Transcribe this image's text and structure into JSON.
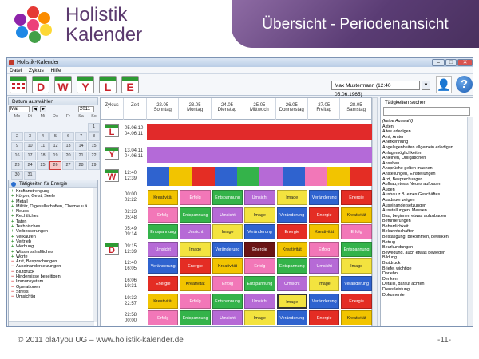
{
  "brand": {
    "line1": "Holistik",
    "line2": "Kalender"
  },
  "slide_title": "Übersicht - Periodenansicht",
  "colors": {
    "Kreativität": "#f2c400",
    "Erfolg": "#f277b8",
    "Entspannung": "#34b34a",
    "Umsicht": "#b66ad6",
    "Image": "#f3e33f",
    "Veränderung": "#2f63cf",
    "Energie": "#e42d24",
    "selected": "#6b1414"
  },
  "window": {
    "title": "Holistik-Kalender",
    "menu": [
      "Datei",
      "Zyklus",
      "Hilfe"
    ],
    "toolbar_letters": [
      "D",
      "W",
      "Y",
      "L",
      "E"
    ],
    "user": "Max Mustermann (12:40 05.06.1965)"
  },
  "calendar": {
    "header": "Datum auswählen",
    "month": "Mai",
    "year": "2011",
    "weekdays": [
      "Mo",
      "Di",
      "Mi",
      "Do",
      "Fr",
      "Sa",
      "So"
    ],
    "days": [
      "",
      "",
      "",
      "",
      "",
      "",
      "1",
      "2",
      "3",
      "4",
      "5",
      "6",
      "7",
      "8",
      "9",
      "10",
      "11",
      "12",
      "13",
      "14",
      "15",
      "16",
      "17",
      "18",
      "19",
      "20",
      "21",
      "22",
      "23",
      "24",
      "25",
      "26",
      "27",
      "28",
      "29",
      "30",
      "31"
    ],
    "week_numbers": [
      "17",
      "18",
      "19",
      "20",
      "21",
      "22"
    ],
    "selected_day": "26"
  },
  "energy_panel": {
    "header": "Tätigkeiten für Energie",
    "items": [
      {
        "sign": "+",
        "label": "Kraftanstrengung"
      },
      {
        "sign": "+",
        "label": "Körper, Geist, Seele"
      },
      {
        "sign": "+",
        "label": "Metall"
      },
      {
        "sign": "+",
        "label": "Militär, Ölgesellschaften, Chemie u.ä."
      },
      {
        "sign": "+",
        "label": "Neues"
      },
      {
        "sign": "+",
        "label": "Rechtliches"
      },
      {
        "sign": "+",
        "label": "Taten"
      },
      {
        "sign": "+",
        "label": "Technisches"
      },
      {
        "sign": "+",
        "label": "Verbesserungen"
      },
      {
        "sign": "+",
        "label": "Verkaufen"
      },
      {
        "sign": "+",
        "label": "Vertrieb"
      },
      {
        "sign": "+",
        "label": "Werbung"
      },
      {
        "sign": "+",
        "label": "Wissenschaftliches"
      },
      {
        "sign": "+",
        "label": "Worte"
      },
      {
        "sign": "−",
        "label": "Arzt, Besprechungen"
      },
      {
        "sign": "−",
        "label": "Auseinandersetzungen"
      },
      {
        "sign": "−",
        "label": "Blutdruck"
      },
      {
        "sign": "−",
        "label": "Hindernisse beseitigen"
      },
      {
        "sign": "−",
        "label": "Immunsystem"
      },
      {
        "sign": "−",
        "label": "Operationen"
      },
      {
        "sign": "−",
        "label": "Stress"
      },
      {
        "sign": "−",
        "label": "Umsichtig"
      }
    ]
  },
  "grid": {
    "col_zyklus": "Zyklus",
    "col_zeit": "Zeit",
    "days": [
      {
        "date": "22.05",
        "weekday": "Sonntag"
      },
      {
        "date": "23.05",
        "weekday": "Montag"
      },
      {
        "date": "24.05",
        "weekday": "Dienstag"
      },
      {
        "date": "25.05",
        "weekday": "Mittwoch"
      },
      {
        "date": "26.05",
        "weekday": "Donnerstag"
      },
      {
        "date": "27.05",
        "weekday": "Freitag"
      },
      {
        "date": "28.05",
        "weekday": "Samstag"
      }
    ],
    "cycle_rows": [
      {
        "letter": "L",
        "time": "05.06.10\n04.06.11",
        "color": "#e12a2a"
      },
      {
        "letter": "Y",
        "time": "13.04.11\n04.06.11",
        "color": "#b46ad8"
      },
      {
        "letter": "W",
        "time": "12:40\n12:39",
        "segments": [
          "#2f63cf",
          "#f2c400",
          "#e42d24",
          "#2f63cf",
          "#34b34a",
          "#b66ad6",
          "#2f63cf",
          "#f277b8",
          "#f2c400",
          "#e42d24"
        ]
      }
    ],
    "day_label": "D",
    "day_rows": [
      {
        "time": "00:00\n02:22",
        "cells": [
          "Kreativität",
          "Erfolg",
          "Entspannung",
          "Umsicht",
          "Image",
          "Veränderung",
          "Energie"
        ]
      },
      {
        "time": "02:23\n05:48",
        "cells": [
          "Erfolg",
          "Entspannung",
          "Umsicht",
          "Image",
          "Veränderung",
          "Energie",
          "Kreativität"
        ]
      },
      {
        "time": "05:49\n09:14",
        "cells": [
          "Entspannung",
          "Umsicht",
          "Image",
          "Veränderung",
          "Energie",
          "Kreativität",
          "Erfolg"
        ]
      },
      {
        "time": "09:15\n12:39",
        "cells": [
          "Umsicht",
          "Image",
          "Veränderung",
          "Energie",
          "Kreativität",
          "Erfolg",
          "Entspannung"
        ],
        "selected_index": 3
      },
      {
        "time": "12:40\n16:05",
        "cells": [
          "Veränderung",
          "Energie",
          "Kreativität",
          "Erfolg",
          "Entspannung",
          "Umsicht",
          "Image"
        ]
      },
      {
        "time": "16:06\n19:31",
        "cells": [
          "Energie",
          "Kreativität",
          "Erfolg",
          "Entspannung",
          "Umsicht",
          "Image",
          "Veränderung"
        ]
      },
      {
        "time": "19:32\n22:57",
        "cells": [
          "Kreativität",
          "Erfolg",
          "Entspannung",
          "Umsicht",
          "Image",
          "Veränderung",
          "Energie"
        ],
        "outlined_index": 4
      },
      {
        "time": "22:58\n00:00",
        "cells": [
          "Erfolg",
          "Entspannung",
          "Umsicht",
          "Image",
          "Veränderung",
          "Energie",
          "Kreativität"
        ]
      }
    ]
  },
  "activities": {
    "header": "Tätigkeiten suchen",
    "items": [
      "(keine Auswahl)",
      "Akten",
      "Altes erledigen",
      "Amt, Ämter",
      "Anerkennung",
      "Angelegenheiten allgemein erledigen",
      "Anlagemöglichkeiten",
      "Anleihen, Obligationen",
      "Ansehen",
      "Ansprüche gelten machen",
      "Anstellungen, Einstellungen",
      "Arzt, Besprechungen",
      "Aufbau,etwas Neues aufbauen",
      "Augen",
      "Ausbau z.B. eines Geschäftes",
      "Ausdauer zeigen",
      "Auseinandersetzungen",
      "Ausstellungen, Messen",
      "Bau, beginnen etwas aufzubauen",
      "Befürderungen",
      "Beharrlichkeit",
      "Bekanntschaften",
      "Bestätigung, bekommen, bewirken",
      "Betrug",
      "Beurkundungen",
      "Bewegung, auch etwas bewegen",
      "Bildung",
      "Blutdruck",
      "Briefe, wichtige",
      "Darlehn",
      "Denken",
      "Details, darauf achten",
      "Dienstleistung",
      "Dokumente"
    ]
  },
  "footer": {
    "copyright": "© 2011 ola4you UG – www.holistik-kalender.de",
    "page": "-11-"
  }
}
